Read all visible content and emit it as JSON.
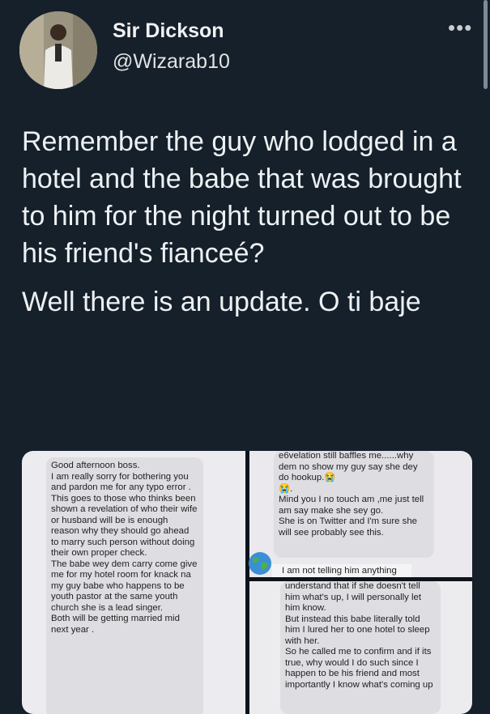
{
  "user": {
    "display_name": "Sir Dickson",
    "handle": "@Wizarab10"
  },
  "tweet": {
    "paragraph_1": "Remember the guy who lodged in a hotel and the babe that was brought to him for the night turned out to be his friend's fianceé?",
    "paragraph_2": "Well there is an update. O ti baje"
  },
  "media": {
    "left_text": "Good afternoon boss.\nI am really sorry  for bothering you and pardon me for any typo error .\nThis goes to those who thinks been shown a revelation of who their wife or husband will be is enough reason why they should go ahead to marry such person without doing their own proper check.\nThe babe wey dem carry come give me for my hotel room for knack na my guy babe who happens to be youth pastor at the same youth church she is a lead singer.\nBoth will be getting married mid next year .",
    "top_right_text": "e6velation still baffles me......why dem no show my guy say she dey do hookup.😭\n😭.\nMind you I no touch am ,me just tell am say make she sey go.\nShe is on Twitter and I'm sure she will see probably see this.",
    "top_right_strip": "I am not telling him anything",
    "bottom_right_text": "understand that if she doesn't tell him what's up, I will personally let him know.\nBut instead this babe literally told him I lured her to one hotel to sleep with her.\nSo he called me to confirm and if its true, why would I do such since I happen to be his friend and most importantly I know what's coming up"
  },
  "icons": {
    "more": "more-options-icon",
    "globe": "globe-emoji-icon"
  },
  "colors": {
    "background": "#15202b",
    "text": "#e7e9ea"
  }
}
